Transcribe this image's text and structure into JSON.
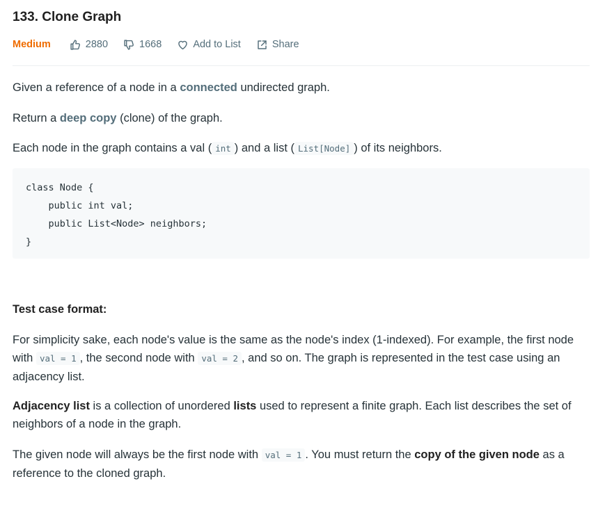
{
  "problem": {
    "title": "133. Clone Graph",
    "difficulty": "Medium",
    "likes": "2880",
    "dislikes": "1668",
    "add_to_list": "Add to List",
    "share": "Share",
    "colors": {
      "difficulty": "#ef6c00",
      "text": "#263238",
      "muted": "#546e7a",
      "code_bg": "#f7f9fa"
    }
  },
  "description": {
    "p1": {
      "pre": "Given a reference of a node in a ",
      "kw": "connected",
      "post": " undirected graph."
    },
    "p2": {
      "pre": "Return a ",
      "kw": "deep copy",
      "post": " (clone) of the graph."
    },
    "p3": {
      "pre": "Each node in the graph contains a val (",
      "code1": "int",
      "mid": ") and a list (",
      "code2": "List[Node]",
      "post": ") of its neighbors."
    },
    "code_block": "class Node {\n    public int val;\n    public List<Node> neighbors;\n}"
  },
  "test_case": {
    "heading": "Test case format:",
    "p1": {
      "a": "For simplicity sake, each node's value is the same as the node's index (1-indexed). For example, the first node with ",
      "code1": "val = 1",
      "b": ", the second node with ",
      "code2": "val = 2",
      "c": ", and so on. The graph is represented in the test case using an adjacency list."
    },
    "p2": {
      "b1": "Adjacency list",
      "a": " is a collection of unordered ",
      "b2": "lists",
      "c": " used to represent a finite graph. Each list describes the set of neighbors of a node in the graph."
    },
    "p3": {
      "a": "The given node will always be the first node with ",
      "code1": "val = 1",
      "b": ". You must return the ",
      "b1": "copy of the given node",
      "c": " as a reference to the cloned graph."
    }
  }
}
